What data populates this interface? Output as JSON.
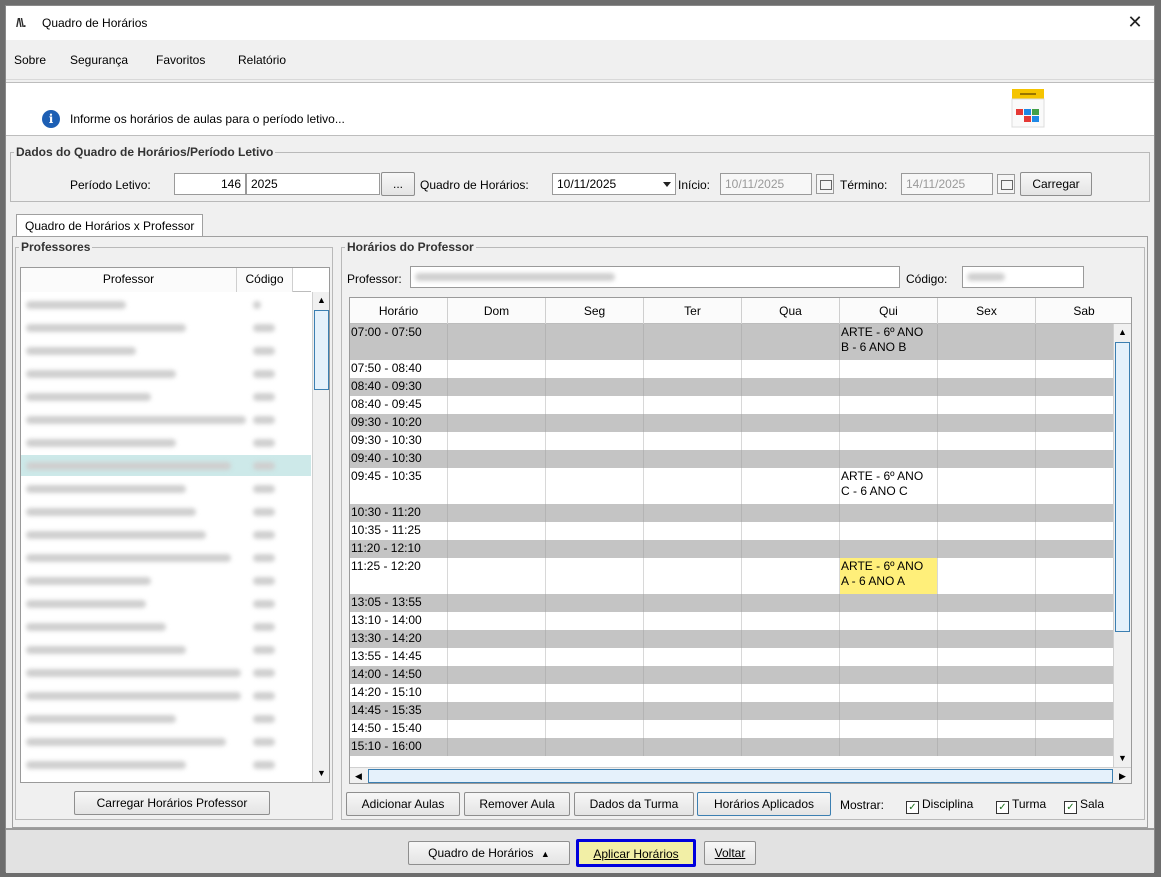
{
  "window": {
    "title": "Quadro de Horários",
    "logo": "/\\\\."
  },
  "menu": [
    {
      "label": "Sobre"
    },
    {
      "label": "Segurança"
    },
    {
      "label": "Favoritos"
    },
    {
      "label": "Relatório"
    }
  ],
  "info": {
    "text": "Informe os horários de aulas para o período letivo..."
  },
  "dados": {
    "title": "Dados do Quadro de Horários/Período Letivo",
    "periodo_label": "Período Letivo:",
    "periodo_code": "146",
    "periodo_name": "2025",
    "ellipsis": "...",
    "quadro_label": "Quadro de Horários:",
    "quadro_value": "10/11/2025",
    "inicio_label": "Início:",
    "inicio_value": "10/11/2025",
    "termino_label": "Término:",
    "termino_value": "14/11/2025",
    "carregar": "Carregar"
  },
  "tab": {
    "label": "Quadro de Horários x Professor"
  },
  "professores": {
    "title": "Professores",
    "col_professor": "Professor",
    "col_codigo": "Código",
    "button": "Carregar Horários Professor"
  },
  "horarios": {
    "title": "Horários do Professor",
    "professor_label": "Professor:",
    "codigo_label": "Código:",
    "columns": [
      "Horário",
      "Dom",
      "Seg",
      "Ter",
      "Qua",
      "Qui",
      "Sex",
      "Sab"
    ],
    "rows": [
      {
        "time": "07:00 - 07:50",
        "qui": "ARTE - 6º ANO",
        "qui2": "B - 6 ANO B"
      },
      {
        "time": "07:50 - 08:40",
        "qui": "",
        "qui2": ""
      },
      {
        "time": "08:40 - 09:30",
        "qui": "",
        "qui2": ""
      },
      {
        "time": "08:40 - 09:45",
        "qui": "",
        "qui2": ""
      },
      {
        "time": "09:30 - 10:20",
        "qui": "",
        "qui2": ""
      },
      {
        "time": "09:30 - 10:30",
        "qui": "",
        "qui2": ""
      },
      {
        "time": "09:40 - 10:30",
        "qui": "",
        "qui2": ""
      },
      {
        "time": "09:45 - 10:35",
        "qui": "ARTE - 6º ANO",
        "qui2": "C - 6 ANO C"
      },
      {
        "time": "10:30 - 11:20",
        "qui": "",
        "qui2": ""
      },
      {
        "time": "10:35 - 11:25",
        "qui": "",
        "qui2": ""
      },
      {
        "time": "11:20 - 12:10",
        "qui": "",
        "qui2": ""
      },
      {
        "time": "11:25 - 12:20",
        "qui": "ARTE - 6º ANO",
        "qui2": "A - 6 ANO A"
      },
      {
        "time": "13:05 - 13:55",
        "qui": "",
        "qui2": ""
      },
      {
        "time": "13:10 - 14:00",
        "qui": "",
        "qui2": ""
      },
      {
        "time": "13:30 - 14:20",
        "qui": "",
        "qui2": ""
      },
      {
        "time": "13:55 - 14:45",
        "qui": "",
        "qui2": ""
      },
      {
        "time": "14:00 - 14:50",
        "qui": "",
        "qui2": ""
      },
      {
        "time": "14:20 - 15:10",
        "qui": "",
        "qui2": ""
      },
      {
        "time": "14:45 - 15:35",
        "qui": "",
        "qui2": ""
      },
      {
        "time": "14:50 - 15:40",
        "qui": "",
        "qui2": ""
      },
      {
        "time": "15:10 - 16:00",
        "qui": "",
        "qui2": ""
      }
    ],
    "buttons": {
      "adicionar": "Adicionar Aulas",
      "remover": "Remover Aula",
      "dados_turma": "Dados da Turma",
      "aplicados": "Horários Aplicados"
    },
    "mostrar_label": "Mostrar:",
    "check_disciplina": "Disciplina",
    "check_turma": "Turma",
    "check_sala": "Sala"
  },
  "footer": {
    "quadro": "Quadro de Horários",
    "aplicar": "Aplicar Horários",
    "voltar": "Voltar"
  },
  "colors": {
    "highlight": "#ffef7a",
    "gray_row": "#c4c4c4",
    "selected_row": "#cde9e9",
    "focus_border": "#0000dd"
  }
}
